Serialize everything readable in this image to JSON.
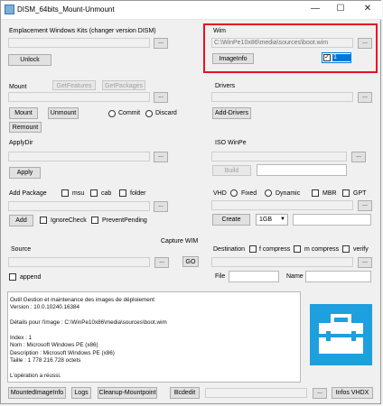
{
  "window": {
    "title": "DISM_64bits_Mount-Unmount",
    "minimize": "—",
    "maximize": "☐",
    "close": "✕"
  },
  "emplacement": {
    "label": "Emplacement Windows Kits (changer version DISM)",
    "browse": "...",
    "unlock": "Unlock"
  },
  "wim": {
    "label": "Wim",
    "path": "C:\\WinPe10x86\\media\\sources\\boot.wim",
    "browse": "...",
    "imageinfo": "ImageInfo",
    "index": "1"
  },
  "mount": {
    "label": "Mount",
    "get_features": "GetFeatures",
    "get_packages": "GetPackages",
    "browse": "...",
    "mount_btn": "Mount",
    "unmount_btn": "Unmount",
    "commit": "Commit",
    "discard": "Discard",
    "remount": "Remount"
  },
  "drivers": {
    "label": "Drivers",
    "browse": "...",
    "add_drivers": "Add-Drivers"
  },
  "applydir": {
    "label": "ApplyDir",
    "browse": "...",
    "apply": "Apply"
  },
  "isowinpe": {
    "label": "ISO WinPe",
    "browse": "...",
    "build": "Build"
  },
  "addpackage": {
    "label": "Add Package",
    "msu": "msu",
    "cab": "cab",
    "folder": "folder",
    "browse": "...",
    "add": "Add",
    "ignorecheck": "IgnoreCheck",
    "preventpending": "PreventPending"
  },
  "vhd": {
    "label": "VHD",
    "fixed": "Fixed",
    "dynamic": "Dynamic",
    "mbr": "MBR",
    "gpt": "GPT",
    "browse": "...",
    "create": "Create",
    "size": "1GB"
  },
  "capture": {
    "source_label": "Source",
    "capture_label": "Capture WIM",
    "browse": "...",
    "go": "GO",
    "append": "append",
    "destination_label": "Destination",
    "f_compress": "f compress",
    "m_compress": "m compress",
    "verify": "verify",
    "dest_browse": "...",
    "file_label": "File",
    "name_label": "Name"
  },
  "output": {
    "lines": [
      "Outil Gestion et maintenance des images de déploiement",
      "Version : 10.0.10240.16384",
      "",
      "Détails pour l'image : C:\\WinPe10x86\\media\\sources\\boot.wim",
      "",
      "Index : 1",
      "Nom : Microsoft Windows PE (x86)",
      "Description : Microsoft Windows PE (x86)",
      "Taille : 1 778 216 728 octets",
      "",
      "L'opération a réussi."
    ]
  },
  "bottom": {
    "mountedimageinfo": "MountedImageInfo",
    "logs": "Logs",
    "cleanup": "Cleanup-Mountpoint",
    "bcdedit": "Bcdedit",
    "browse": "...",
    "infos_vhdx": "Infos VHDX"
  },
  "colors": {
    "highlight": "#e81123",
    "accent": "#1e9fde"
  },
  "icons": [
    "app-icon",
    "toolbox-icon",
    "close-icon"
  ]
}
